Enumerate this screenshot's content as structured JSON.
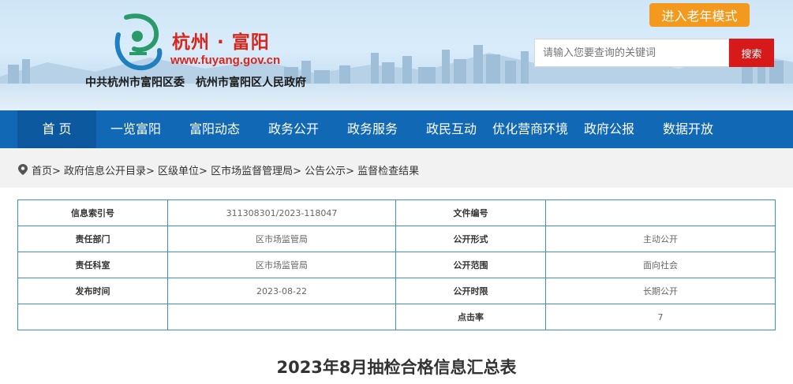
{
  "header": {
    "site_title": "杭州 · 富阳",
    "site_url": "www.fuyang.gov.cn",
    "org_left": "中共杭州市富阳区委",
    "org_right": "杭州市富阳区人民政府",
    "elder_mode_label": "进入老年模式",
    "search_placeholder": "请输入您要查询的关键词",
    "search_button_label": "搜索",
    "logo_icon": "fuyang-emblem-icon",
    "accent_color": "#d7261e"
  },
  "nav": {
    "color": "#1168b4",
    "items": [
      {
        "label": "首 页",
        "active": true
      },
      {
        "label": "一览富阳"
      },
      {
        "label": "富阳动态"
      },
      {
        "label": "政务公开"
      },
      {
        "label": "政务服务"
      },
      {
        "label": "政民互动"
      },
      {
        "label": "优化营商环境"
      },
      {
        "label": "政府公报"
      },
      {
        "label": "数据开放"
      }
    ]
  },
  "breadcrumb": {
    "icon": "location-pin-icon",
    "text": "首页> 政府信息公开目录> 区级单位> 区市场监督管理局> 公告公示> 监督检查结果"
  },
  "meta": {
    "rows": [
      {
        "k1": "信息索引号",
        "v1": "311308301/2023-118047",
        "k2": "文件编号",
        "v2": ""
      },
      {
        "k1": "责任部门",
        "v1": "区市场监管局",
        "k2": "公开形式",
        "v2": "主动公开"
      },
      {
        "k1": "责任科室",
        "v1": "区市场监管局",
        "k2": "公开范围",
        "v2": "面向社会"
      },
      {
        "k1": "发布时间",
        "v1": "2023-08-22",
        "k2": "公开时限",
        "v2": "长期公开"
      },
      {
        "k1": "",
        "v1": "",
        "k2": "点击率",
        "v2": "7"
      }
    ]
  },
  "document": {
    "title": "2023年8月抽检合格信息汇总表"
  }
}
